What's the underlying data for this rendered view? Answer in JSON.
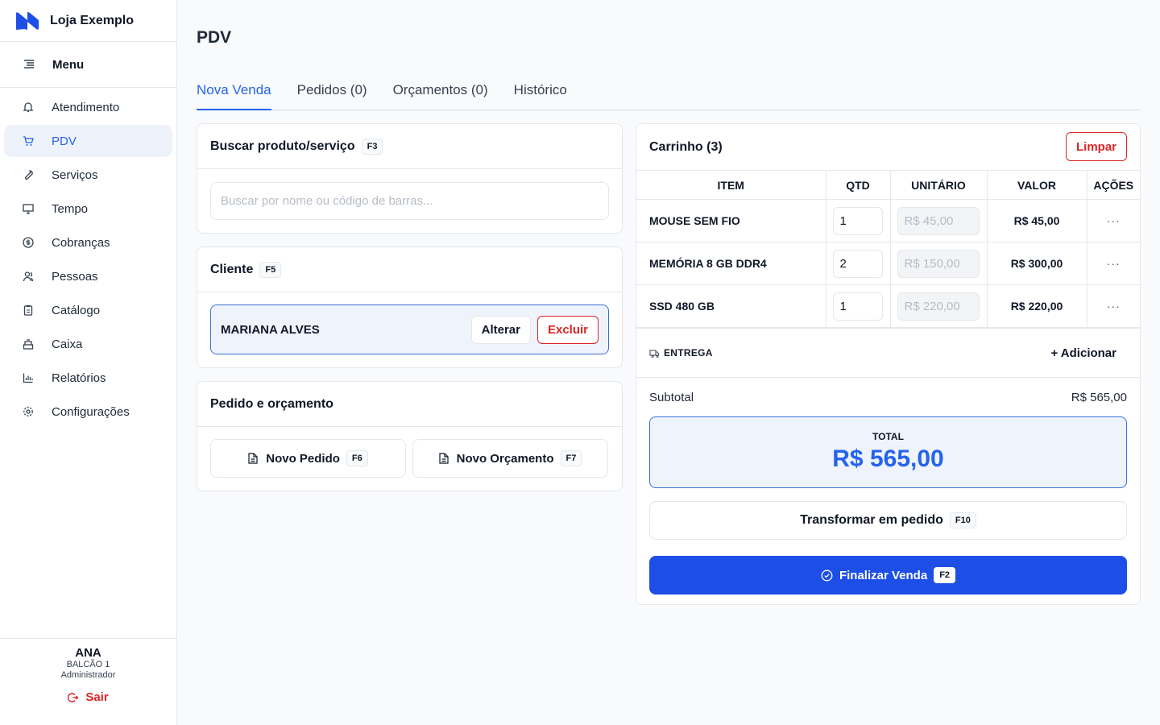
{
  "app": {
    "brand": "Loja Exemplo",
    "accent": "#2563eb"
  },
  "sidebar": {
    "menu_label": "Menu",
    "items": [
      {
        "label": "Atendimento",
        "icon": "bell-icon"
      },
      {
        "label": "PDV",
        "icon": "cart-icon"
      },
      {
        "label": "Serviços",
        "icon": "wrench-icon"
      },
      {
        "label": "Tempo",
        "icon": "monitor-icon"
      },
      {
        "label": "Cobranças",
        "icon": "dollar-circle-icon"
      },
      {
        "label": "Pessoas",
        "icon": "people-icon"
      },
      {
        "label": "Catálogo",
        "icon": "clipboard-icon"
      },
      {
        "label": "Caixa",
        "icon": "register-icon"
      },
      {
        "label": "Relatórios",
        "icon": "chart-icon"
      },
      {
        "label": "Configurações",
        "icon": "gear-icon"
      }
    ],
    "active": "PDV",
    "user": {
      "name": "ANA",
      "station": "BALCÃO 1",
      "role": "Administrador"
    },
    "logout": "Sair"
  },
  "main": {
    "title": "PDV",
    "tabs": [
      {
        "label": "Nova Venda"
      },
      {
        "label": "Pedidos (0)"
      },
      {
        "label": "Orçamentos (0)"
      },
      {
        "label": "Histórico"
      }
    ],
    "search": {
      "title": "Buscar produto/serviço",
      "shortcut": "F3",
      "placeholder": "Buscar por nome ou código de barras..."
    },
    "client": {
      "title": "Cliente",
      "shortcut": "F5",
      "name": "MARIANA ALVES",
      "change": "Alterar",
      "remove": "Excluir"
    },
    "orders": {
      "title": "Pedido e orçamento",
      "new_order": "Novo Pedido",
      "new_order_shortcut": "F6",
      "new_quote": "Novo Orçamento",
      "new_quote_shortcut": "F7"
    }
  },
  "cart": {
    "title": "Carrinho (3)",
    "clear": "Limpar",
    "columns": [
      "ITEM",
      "QTD",
      "UNITÁRIO",
      "VALOR",
      "AÇÕES"
    ],
    "rows": [
      {
        "item": "MOUSE SEM FIO",
        "qty": "1",
        "unit": "R$ 45,00",
        "value": "R$ 45,00",
        "actions": "···"
      },
      {
        "item": "MEMÓRIA 8 GB DDR4",
        "qty": "2",
        "unit": "R$ 150,00",
        "value": "R$ 300,00",
        "actions": "···"
      },
      {
        "item": "SSD 480 GB",
        "qty": "1",
        "unit": "R$ 220,00",
        "value": "R$ 220,00",
        "actions": "···"
      }
    ],
    "delivery_label": "ENTREGA",
    "delivery_add": "+ Adicionar",
    "subtotal_label": "Subtotal",
    "subtotal_value": "R$ 565,00",
    "total_label": "TOTAL",
    "total_value": "R$ 565,00",
    "convert": "Transformar em pedido",
    "convert_shortcut": "F10",
    "finish": "Finalizar Venda",
    "finish_shortcut": "F2"
  }
}
